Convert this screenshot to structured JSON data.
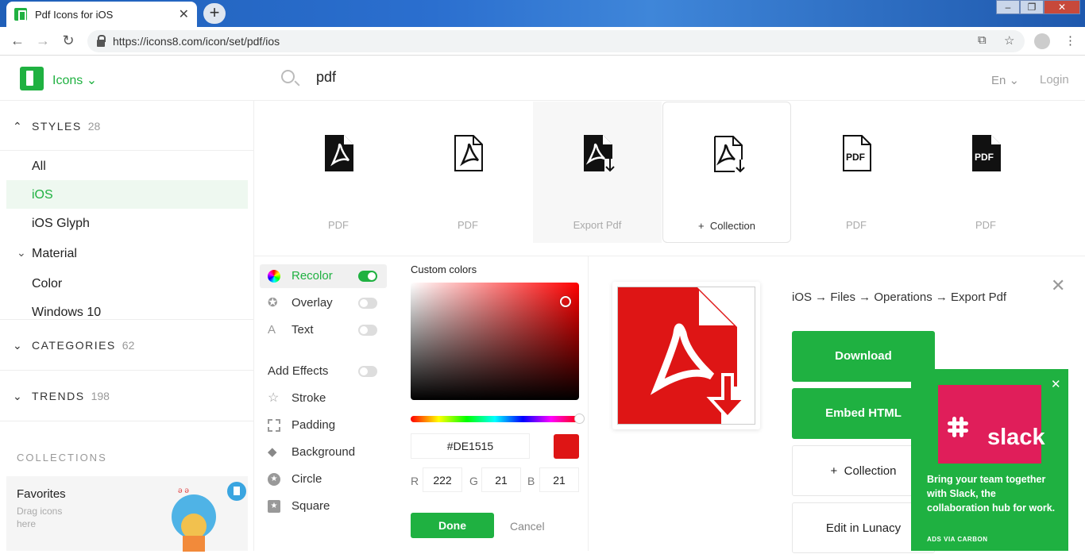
{
  "browser": {
    "tab_title": "Pdf Icons for iOS",
    "url": "https://icons8.com/icon/set/pdf/ios",
    "window_buttons": [
      "minimize",
      "restore",
      "close"
    ]
  },
  "header": {
    "brand": "Icons",
    "search_value": "pdf",
    "lang": "En",
    "login": "Login"
  },
  "sidebar": {
    "styles_label": "STYLES",
    "styles_count": "28",
    "items": [
      "All",
      "iOS",
      "iOS Glyph",
      "Material",
      "Color",
      "Windows 10"
    ],
    "active_item": "iOS",
    "categories_label": "CATEGORIES",
    "categories_count": "62",
    "trends_label": "TRENDS",
    "trends_count": "198",
    "collections_label": "COLLECTIONS",
    "favorites_title": "Favorites",
    "favorites_sub": "Drag icons here"
  },
  "icons": [
    {
      "label": "PDF",
      "variant": "filled-acrobat"
    },
    {
      "label": "PDF",
      "variant": "outline-acrobat"
    },
    {
      "label": "Export Pdf",
      "variant": "filled-export"
    },
    {
      "label": "Collection",
      "variant": "outline-export"
    },
    {
      "label": "PDF",
      "variant": "outline-text"
    },
    {
      "label": "PDF",
      "variant": "filled-text"
    }
  ],
  "icon_text": "PDF",
  "collection_label": "Collection",
  "effects": {
    "recolor": "Recolor",
    "overlay": "Overlay",
    "text": "Text",
    "add_effects": "Add Effects",
    "stroke": "Stroke",
    "padding": "Padding",
    "background": "Background",
    "circle": "Circle",
    "square": "Square"
  },
  "color_picker": {
    "title": "Custom colors",
    "hex": "#DE1515",
    "r_label": "R",
    "g_label": "G",
    "b_label": "B",
    "r": "222",
    "g": "21",
    "b": "21",
    "done": "Done",
    "cancel": "Cancel"
  },
  "detail": {
    "breadcrumb": "iOS → Files → Operations → Export Pdf",
    "download": "Download",
    "embed": "Embed HTML",
    "collection": "Collection",
    "lunacy": "Edit in Lunacy"
  },
  "ad": {
    "brand": "slack",
    "text": "Bring your team together with Slack, the collaboration hub for work.",
    "via": "ADS VIA CARBON"
  },
  "colors": {
    "accent": "#1fb141",
    "icon_red": "#DE1515",
    "slack_pink": "#e01e5a"
  }
}
